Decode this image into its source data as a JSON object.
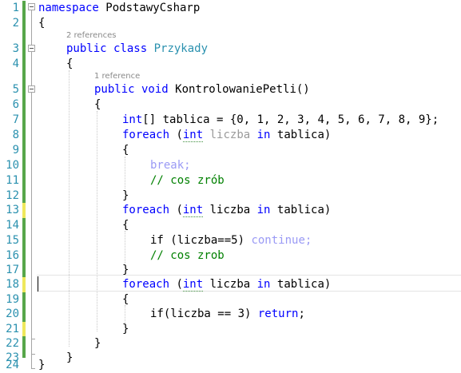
{
  "lines": [
    {
      "n": "1",
      "status": "green"
    },
    {
      "n": "2",
      "status": "green"
    },
    {
      "n": "3",
      "status": "green"
    },
    {
      "n": "4",
      "status": "green"
    },
    {
      "n": "5",
      "status": "green"
    },
    {
      "n": "6",
      "status": "green"
    },
    {
      "n": "7",
      "status": "green"
    },
    {
      "n": "8",
      "status": "green"
    },
    {
      "n": "9",
      "status": "green"
    },
    {
      "n": "10",
      "status": "green"
    },
    {
      "n": "11",
      "status": "green"
    },
    {
      "n": "12",
      "status": "green"
    },
    {
      "n": "13",
      "status": "yellow"
    },
    {
      "n": "14",
      "status": "green"
    },
    {
      "n": "15",
      "status": "green"
    },
    {
      "n": "16",
      "status": "green"
    },
    {
      "n": "17",
      "status": "green"
    },
    {
      "n": "18",
      "status": "yellow"
    },
    {
      "n": "19",
      "status": "green"
    },
    {
      "n": "20",
      "status": "green"
    },
    {
      "n": "21",
      "status": "yellow"
    },
    {
      "n": "22",
      "status": "green"
    },
    {
      "n": "23",
      "status": "green"
    },
    {
      "n": "24",
      "status": "none"
    }
  ],
  "lens": {
    "class_refs": "2 references",
    "method_refs": "1 reference"
  },
  "code": {
    "l1_kw": "namespace",
    "l1_name": " PodstawyCsharp",
    "brace_open": "{",
    "brace_close": "}",
    "l3_kw": "public class",
    "l3_name": " Przykady",
    "l5_kw1": "public",
    "l5_kw2": " void",
    "l5_name": " KontrolowaniePetli()",
    "l7_kw": "int",
    "l7_rest": "[] tablica = {0, 1, 2, 3, 4, 5, 6, 7, 8, 9};",
    "foreach_kw": "foreach",
    "paren_open": " (",
    "int_kw": "int",
    "liczba_sp": " liczba",
    "in_kw": " in",
    "tablica_close": " tablica)",
    "l10_break": "break;",
    "l11_comment": "// cos zrób",
    "l15_if": "if (liczba==5) ",
    "l15_continue": "continue;",
    "l16_comment": "// cos zrob",
    "l20_if": "if(liczba == 3) ",
    "l20_return": "return",
    "l20_semi": ";"
  },
  "colors": {
    "linenumber": "#2b91af",
    "saved_green": "#57a64a",
    "unsaved_yellow": "#efe85c",
    "keyword": "#0000ff",
    "type": "#2b91af",
    "comment": "#008000"
  }
}
